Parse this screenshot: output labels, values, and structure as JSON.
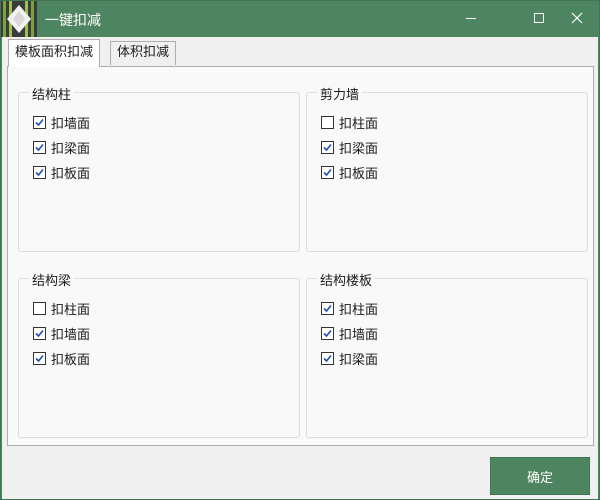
{
  "window": {
    "title": "一键扣减",
    "controls": {
      "minimize": "minimize-icon",
      "maximize": "maximize-icon",
      "close": "close-icon"
    }
  },
  "tabs": [
    {
      "label": "模板面积扣减",
      "active": true
    },
    {
      "label": "体积扣减",
      "active": false
    }
  ],
  "groups": [
    {
      "title": "结构柱",
      "options": [
        {
          "label": "扣墙面",
          "checked": true
        },
        {
          "label": "扣梁面",
          "checked": true
        },
        {
          "label": "扣板面",
          "checked": true
        }
      ]
    },
    {
      "title": "剪力墙",
      "options": [
        {
          "label": "扣柱面",
          "checked": false
        },
        {
          "label": "扣梁面",
          "checked": true
        },
        {
          "label": "扣板面",
          "checked": true
        }
      ]
    },
    {
      "title": "结构梁",
      "options": [
        {
          "label": "扣柱面",
          "checked": false
        },
        {
          "label": "扣墙面",
          "checked": true
        },
        {
          "label": "扣板面",
          "checked": true
        }
      ]
    },
    {
      "title": "结构楼板",
      "options": [
        {
          "label": "扣柱面",
          "checked": true
        },
        {
          "label": "扣墙面",
          "checked": true
        },
        {
          "label": "扣梁面",
          "checked": true
        }
      ]
    }
  ],
  "footer": {
    "ok_label": "确定"
  },
  "colors": {
    "accent": "#4e8561",
    "check": "#1f4fb5"
  }
}
